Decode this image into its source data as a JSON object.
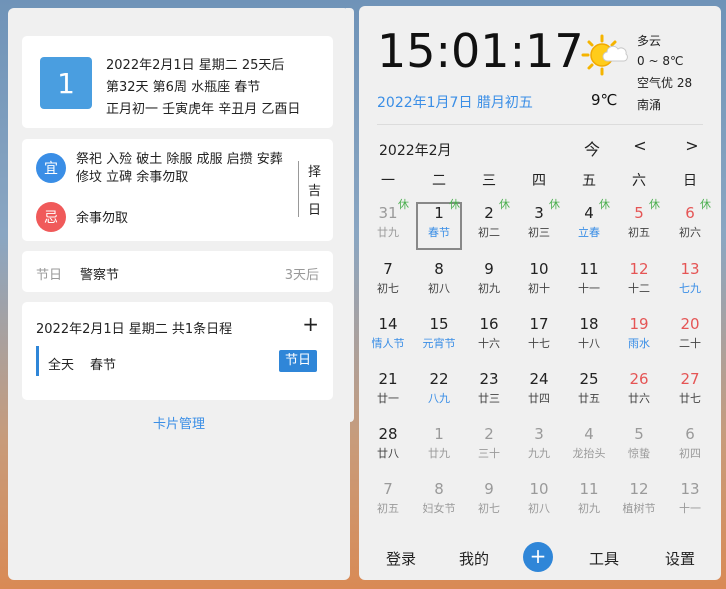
{
  "left": {
    "day_number": "1",
    "date_lines": [
      "2022年2月1日 星期二 25天后",
      "第32天 第6周 水瓶座 春节",
      "正月初一 壬寅虎年 辛丑月 乙酉日"
    ],
    "yi_label": "宜",
    "yi_text": "祭祀 入殓 破土 除服 成服 启攒 安葬 修坟 立碑 余事勿取",
    "ji_label": "忌",
    "ji_text": "余事勿取",
    "zeji": "择吉日",
    "festival": {
      "label": "节日",
      "name": "警察节",
      "days": "3天后"
    },
    "schedule": {
      "title": "2022年2月1日 星期二 共1条日程",
      "add": "+",
      "allday": "全天",
      "event": "春节",
      "tag": "节日"
    },
    "card_manage": "卡片管理"
  },
  "right": {
    "clock": "15:01:17",
    "today": "2022年1月7日 腊月初五",
    "temp_now": "9℃",
    "weather_lines": [
      "多云",
      "0 ~ 8℃",
      "空气优 28",
      "南涌"
    ],
    "month_title": "2022年2月",
    "nav": {
      "today": "今",
      "prev": "<",
      "next": ">"
    },
    "weekdays": [
      "一",
      "二",
      "三",
      "四",
      "五",
      "六",
      "日"
    ],
    "rest_label": "休",
    "cells": [
      {
        "n": "31",
        "l": "廿九",
        "other": true,
        "rest": true
      },
      {
        "n": "1",
        "l": "春节",
        "fest": true,
        "rest": true,
        "selected": true
      },
      {
        "n": "2",
        "l": "初二",
        "rest": true
      },
      {
        "n": "3",
        "l": "初三",
        "rest": true
      },
      {
        "n": "4",
        "l": "立春",
        "fest": true,
        "rest": true
      },
      {
        "n": "5",
        "l": "初五",
        "weekend": true,
        "rest": true
      },
      {
        "n": "6",
        "l": "初六",
        "weekend": true,
        "rest": true
      },
      {
        "n": "7",
        "l": "初七"
      },
      {
        "n": "8",
        "l": "初八"
      },
      {
        "n": "9",
        "l": "初九"
      },
      {
        "n": "10",
        "l": "初十"
      },
      {
        "n": "11",
        "l": "十一"
      },
      {
        "n": "12",
        "l": "十二",
        "weekend": true
      },
      {
        "n": "13",
        "l": "七九",
        "weekend": true,
        "fest": true
      },
      {
        "n": "14",
        "l": "情人节",
        "fest": true
      },
      {
        "n": "15",
        "l": "元宵节",
        "fest": true
      },
      {
        "n": "16",
        "l": "十六"
      },
      {
        "n": "17",
        "l": "十七"
      },
      {
        "n": "18",
        "l": "十八"
      },
      {
        "n": "19",
        "l": "雨水",
        "weekend": true,
        "fest": true
      },
      {
        "n": "20",
        "l": "二十",
        "weekend": true
      },
      {
        "n": "21",
        "l": "廿一"
      },
      {
        "n": "22",
        "l": "八九",
        "fest": true
      },
      {
        "n": "23",
        "l": "廿三"
      },
      {
        "n": "24",
        "l": "廿四"
      },
      {
        "n": "25",
        "l": "廿五"
      },
      {
        "n": "26",
        "l": "廿六",
        "weekend": true
      },
      {
        "n": "27",
        "l": "廿七",
        "weekend": true
      },
      {
        "n": "28",
        "l": "廿八"
      },
      {
        "n": "1",
        "l": "廿九",
        "other": true
      },
      {
        "n": "2",
        "l": "三十",
        "other": true
      },
      {
        "n": "3",
        "l": "九九",
        "other": true
      },
      {
        "n": "4",
        "l": "龙抬头",
        "other": true
      },
      {
        "n": "5",
        "l": "惊蛰",
        "other": true
      },
      {
        "n": "6",
        "l": "初四",
        "other": true
      },
      {
        "n": "7",
        "l": "初五",
        "other": true
      },
      {
        "n": "8",
        "l": "妇女节",
        "other": true
      },
      {
        "n": "9",
        "l": "初七",
        "other": true
      },
      {
        "n": "10",
        "l": "初八",
        "other": true
      },
      {
        "n": "11",
        "l": "初九",
        "other": true
      },
      {
        "n": "12",
        "l": "植树节",
        "other": true
      },
      {
        "n": "13",
        "l": "十一",
        "other": true
      }
    ],
    "bottom": {
      "login": "登录",
      "mine": "我的",
      "plus": "+",
      "tools": "工具",
      "settings": "设置"
    }
  },
  "colors": {
    "accent": "#2f86d8",
    "weekend": "#e55555",
    "rest": "#4caf50",
    "ji": "#f05a5a",
    "yi": "#3a8ee6"
  },
  "icons": {
    "weather": "partly-cloudy-sun-icon"
  }
}
